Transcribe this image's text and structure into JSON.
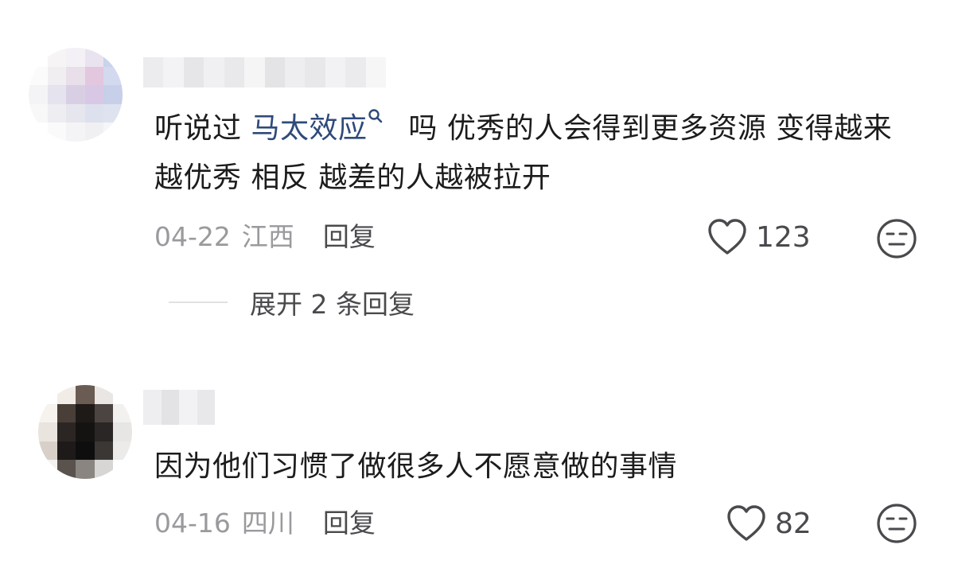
{
  "comments": [
    {
      "text_before": "听说过 ",
      "keyword": "马太效应",
      "keyword_icon": "search-icon",
      "text_after": " 吗 优秀的人会得到更多资源 变得越来越优秀 相反 越差的人越被拉开",
      "date": "04-22",
      "region": "江西",
      "reply_label": "回复",
      "likes": "123",
      "expand_label": "展开 2 条回复"
    },
    {
      "text": "因为他们习惯了做很多人不愿意做的事情",
      "date": "04-16",
      "region": "四川",
      "reply_label": "回复",
      "likes": "82"
    }
  ],
  "colors": {
    "keyword": "#2f4a7a",
    "meta_gray": "#9a9a9e",
    "action_gray": "#4a4a4e"
  },
  "icons": {
    "like": "heart-outline-icon",
    "reaction": "neutral-face-icon"
  }
}
